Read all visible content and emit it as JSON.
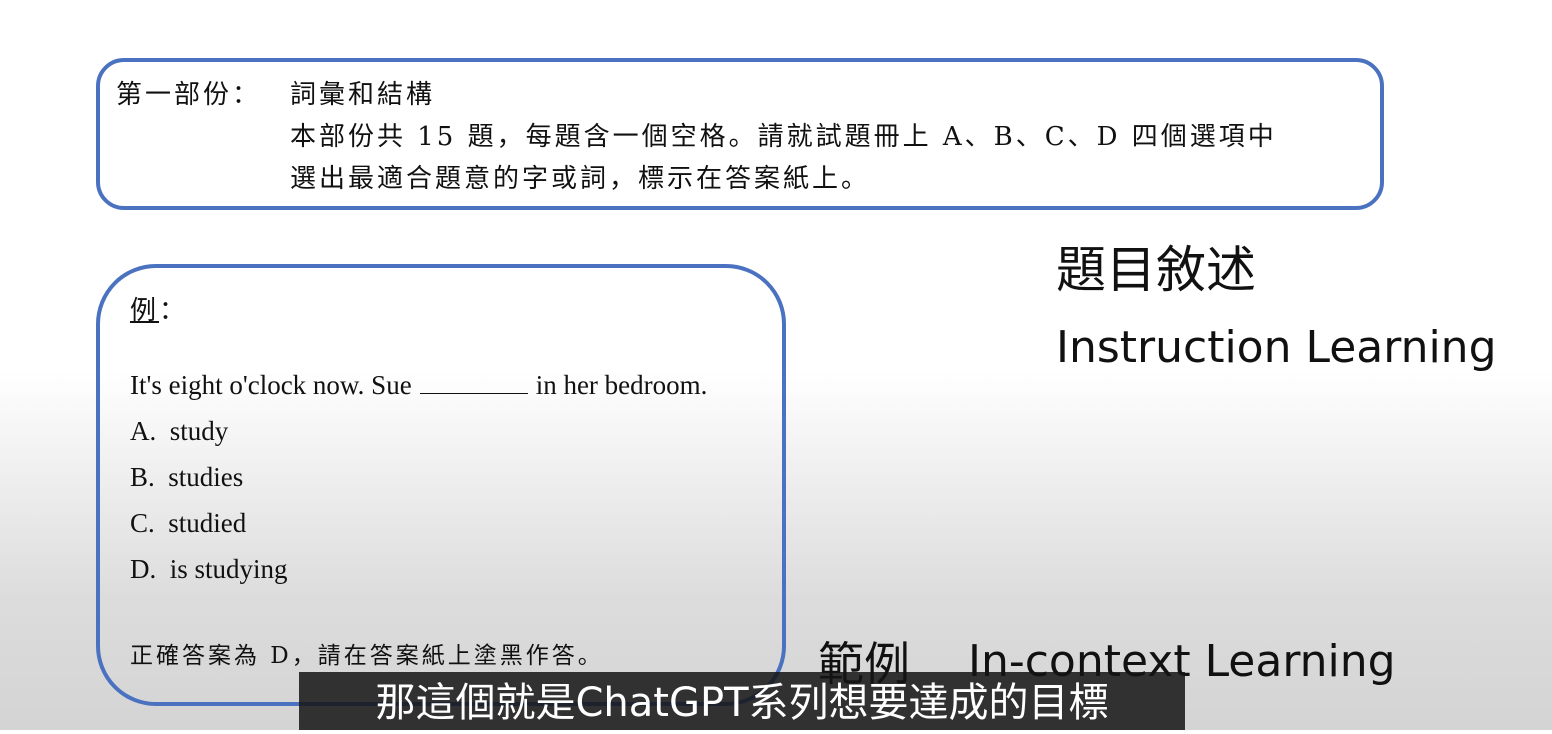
{
  "part_box": {
    "heading": "第一部份：",
    "section": "詞彙和結構",
    "line1": "本部份共 15 題，每題含一個空格。請就試題冊上 A、B、C、D 四個選項中",
    "line2": "選出最適合題意的字或詞，標示在答案紙上。"
  },
  "example_box": {
    "label": "例",
    "colon": "：",
    "question_before": "It's eight o'clock now. Sue",
    "question_after": "in her bedroom.",
    "options": [
      "A.  study",
      "B.  studies",
      "C.  studied",
      "D.  is studying"
    ],
    "answer_note": "正確答案為 D，請在答案紙上塗黑作答。"
  },
  "labels": {
    "instruction_cn": "題目敘述",
    "instruction_en": "Instruction Learning",
    "example_cn": "範例",
    "example_en": "In-context Learning"
  },
  "subtitle": "那這個就是ChatGPT系列想要達成的目標",
  "colors": {
    "border": "#4a72c0"
  }
}
